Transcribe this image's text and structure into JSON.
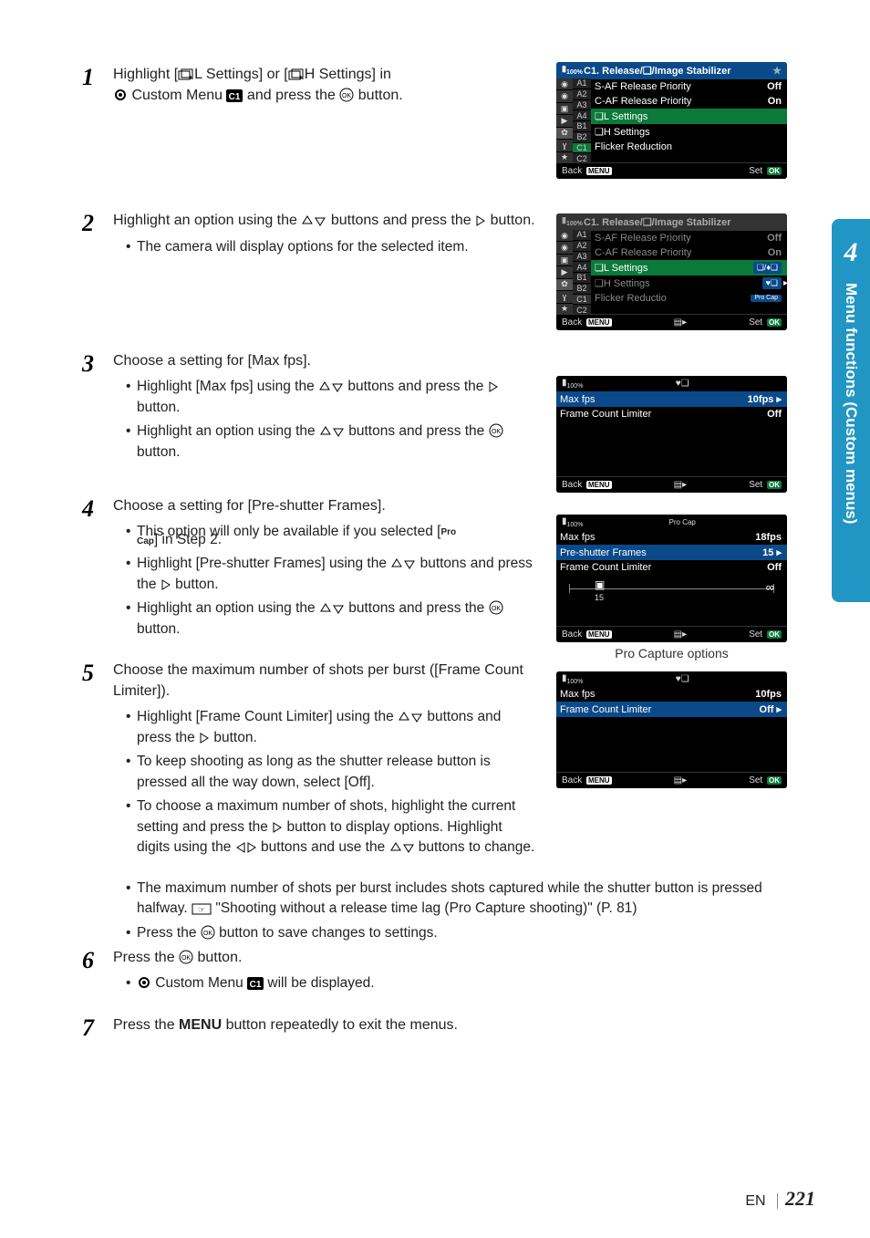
{
  "chapter_tab": {
    "number": "4",
    "title": "Menu functions (Custom menus)"
  },
  "footer": {
    "lang": "EN",
    "page": "221"
  },
  "steps": {
    "s1": {
      "text_a": "Highlight [",
      "text_b": "L Settings] or [",
      "text_c": "H Settings] in ",
      "text_d": " Custom Menu ",
      "text_e": " and press the ",
      "text_f": " button."
    },
    "s2": {
      "text_a": "Highlight an option using the ",
      "text_b": " buttons and press the ",
      "text_c": " button.",
      "bul1": "The camera will display options for the selected item."
    },
    "s3": {
      "text_a": "Choose a setting for [Max fps].",
      "b1a": "Highlight [Max fps] using the ",
      "b1b": " buttons and press the ",
      "b1c": " button.",
      "b2a": "Highlight an option using the ",
      "b2b": " buttons and press the ",
      "b2c": " button."
    },
    "s4": {
      "text_a": "Choose a setting for [Pre-shutter Frames].",
      "b1a": "This option will only be available if you selected [",
      "b1b": "] in Step 2.",
      "b2a": "Highlight [Pre-shutter Frames] using the ",
      "b2b": " buttons and press the ",
      "b2c": " button.",
      "b3a": "Highlight an option using the ",
      "b3b": " buttons and press the ",
      "b3c": " button."
    },
    "s5": {
      "text_a": "Choose the maximum number of shots per burst ([Frame Count Limiter]).",
      "b1a": "Highlight [Frame Count Limiter] using the ",
      "b1b": " buttons and press the ",
      "b1c": " button.",
      "b2": "To keep shooting as long as the shutter release button is pressed all the way down, select [Off].",
      "b3a": "To choose a maximum number of shots, highlight the current setting and press the ",
      "b3b": " button to display options. Highlight digits using the ",
      "b3c": " buttons and use the ",
      "b3d": " buttons to change.",
      "b4a": "The maximum number of shots per burst includes shots captured while the shutter button is pressed halfway. ",
      "b4b": " \"Shooting without a release time lag (Pro Capture shooting)\" (P. 81)",
      "b5a": "Press the ",
      "b5b": " button to save changes to settings."
    },
    "s6": {
      "text_a": "Press the ",
      "text_b": " button.",
      "b1a": " Custom Menu ",
      "b1b": " will be displayed."
    },
    "s7": {
      "text_a": "Press the ",
      "text_b": "MENU",
      "text_c": " button repeatedly to exit the menus."
    }
  },
  "shot1": {
    "title": "C1. Release/❏/Image Stabilizer",
    "rows": [
      {
        "label": "S-AF Release Priority",
        "val": "Off"
      },
      {
        "label": "C-AF Release Priority",
        "val": "On"
      },
      {
        "label": "❏L Settings",
        "val": ""
      },
      {
        "label": "❏H Settings",
        "val": ""
      },
      {
        "label": "Flicker Reduction",
        "val": ""
      }
    ],
    "back": "Back",
    "set": "Set"
  },
  "shot2": {
    "title": "C1. Release/❏/Image Stabilizer",
    "rows": [
      {
        "label": "S-AF Release Priority",
        "val": "Off"
      },
      {
        "label": "C-AF Release Priority",
        "val": "On"
      },
      {
        "label": "❏L Settings",
        "popup": "❏/♦❏"
      },
      {
        "label": "❏H Settings",
        "popup": "♥❏"
      },
      {
        "label": "Flicker Reductio",
        "popup": "Pro Cap"
      }
    ],
    "back": "Back",
    "set": "Set"
  },
  "shot3": {
    "hdr_icon": "♥❏",
    "rows": [
      {
        "label": "Max fps",
        "val": "10fps",
        "sel": true
      },
      {
        "label": "Frame Count Limiter",
        "val": "Off"
      }
    ],
    "back": "Back",
    "set": "Set"
  },
  "shot4": {
    "hdr_icon": "Pro Cap",
    "rows": [
      {
        "label": "Max fps",
        "val": "18fps"
      },
      {
        "label": "Pre-shutter Frames",
        "val": "15",
        "sel": true
      },
      {
        "label": "Frame Count Limiter",
        "val": "Off"
      }
    ],
    "slider": {
      "pos_label": "15",
      "inf": "∞"
    },
    "back": "Back",
    "set": "Set",
    "caption": "Pro Capture options"
  },
  "shot5": {
    "hdr_icon": "♥❏",
    "rows": [
      {
        "label": "Max fps",
        "val": "10fps"
      },
      {
        "label": "Frame Count Limiter",
        "val": "Off",
        "sel": true
      }
    ],
    "back": "Back",
    "set": "Set"
  },
  "side_labels": [
    "A1",
    "A2",
    "A3",
    "A4",
    "B1",
    "B2",
    "C1",
    "C2"
  ],
  "menu_tag": "MENU",
  "ok_tag": "OK"
}
